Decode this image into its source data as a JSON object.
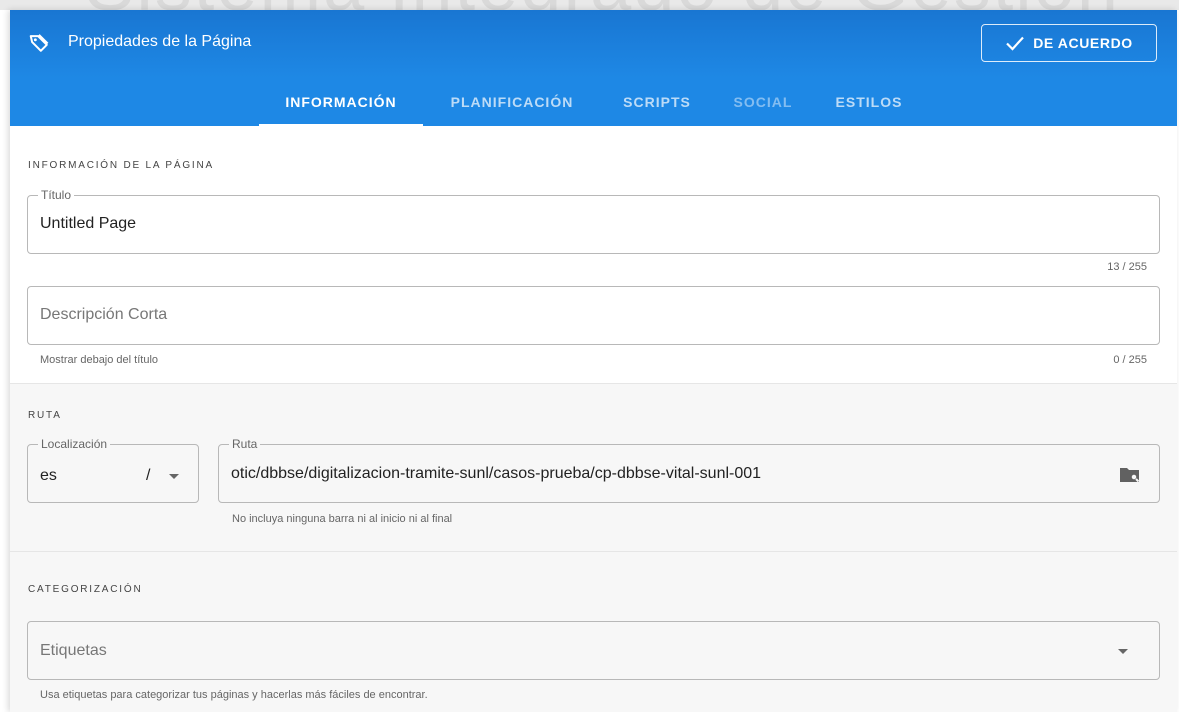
{
  "background": {
    "ghost_text": "Sistema Integrado de Gestión"
  },
  "dialog": {
    "title": "Propiedades de la Página",
    "ok_label": "DE ACUERDO",
    "accent_color": "#1e88e5"
  },
  "tabs": [
    {
      "label": "INFORMACIÓN",
      "state": "active"
    },
    {
      "label": "PLANIFICACIÓN",
      "state": "normal"
    },
    {
      "label": "SCRIPTS",
      "state": "normal"
    },
    {
      "label": "SOCIAL",
      "state": "disabled"
    },
    {
      "label": "ESTILOS",
      "state": "normal"
    }
  ],
  "info": {
    "heading": "INFORMACIÓN DE LA PÁGINA",
    "title_label": "Título",
    "title_value": "Untitled Page",
    "title_counter": "13 / 255",
    "description_placeholder": "Descripción Corta",
    "description_hint": "Mostrar debajo del título",
    "description_counter": "0 / 255"
  },
  "route": {
    "heading": "RUTA",
    "locale_label": "Localización",
    "locale_value": "es",
    "locale_separator": "/",
    "path_label": "Ruta",
    "path_value": "otic/dbbse/digitalizacion-tramite-sunl/casos-prueba/cp-dbbse-vital-sunl-001",
    "path_hint": "No incluya ninguna barra ni al inicio ni al final"
  },
  "categorization": {
    "heading": "CATEGORIZACIÓN",
    "tags_placeholder": "Etiquetas",
    "tags_hint": "Usa etiquetas para categorizar tus páginas y hacerlas más fáciles de encontrar."
  }
}
